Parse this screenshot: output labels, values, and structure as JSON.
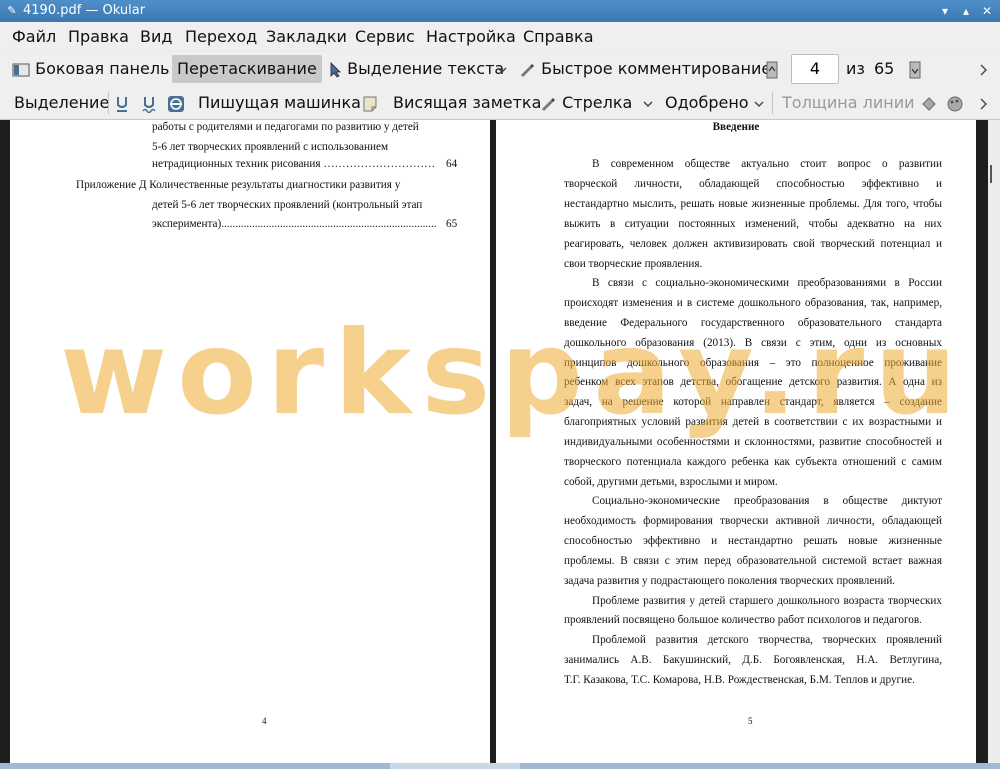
{
  "window": {
    "title": "4190.pdf  — Okular"
  },
  "menu": [
    "Файл",
    "Правка",
    "Вид",
    "Переход",
    "Закладки",
    "Сервис",
    "Настройка",
    "Справка"
  ],
  "toolbar1": {
    "sidebar": "Боковая панель",
    "drag": "Перетаскивание",
    "text_select": "Выделение текста",
    "quick_comment": "Быстрое комментирование",
    "page_current": "4",
    "page_of": "из",
    "page_total": "65"
  },
  "toolbar2": {
    "highlight": "Выделение",
    "typewriter": "Пишущая машинка",
    "note": "Висящая заметка",
    "arrow": "Стрелка",
    "approved": "Одобрено",
    "line_width": "Толщина линии"
  },
  "page_left": {
    "toc": [
      {
        "text": "работы с родителями и педагогами по развитию у детей",
        "page": ""
      },
      {
        "text": "5-6 лет творческих проявлений с использованием",
        "page": ""
      },
      {
        "text": "нетрадиционных техник рисования …………………………",
        "page": "64"
      },
      {
        "text": "Приложение Д Количественные результаты диагностики развития у",
        "page": ""
      },
      {
        "text": "детей 5-6 лет творческих проявлений (контрольный этап",
        "page": ""
      },
      {
        "text": "эксперимента)..............................................................................",
        "page": "65"
      }
    ],
    "page_number": "4"
  },
  "page_right": {
    "heading": "Введение",
    "lines": [
      "В современном обществе актуально стоит вопрос о развитии",
      "творческой личности, обладающей способностью эффективно и",
      "нестандартно мыслить, решать новые жизненные проблемы. Для того, чтобы",
      "выжить в ситуации постоянных изменений, чтобы адекватно на них",
      "реагировать, человек должен активизировать свой творческий потенциал и",
      "свои творческие проявления.",
      "В связи с социально-экономическими преобразованиями в России",
      "происходят изменения и в системе дошкольного образования, так, например,",
      "введение Федерального государственного образовательного стандарта",
      "дошкольного образования (2013). В связи с этим, одни из основных",
      "принципов дошкольного образования – это полноценное проживание",
      "ребенком всех этапов детства, обогащение детского развития. А одна из",
      "задач, на решение которой направлен стандарт, является – создание",
      "благоприятных условий развития детей в соответствии с их возрастными и",
      "индивидуальными особенностями и склонностями, развитие способностей и",
      "творческого потенциала каждого ребенка как субъекта отношений с самим",
      "собой, другими детьми, взрослыми и миром.",
      "Социально-экономические преобразования в обществе диктуют",
      "необходимость формирования творчески активной личности, обладающей",
      "способностью эффективно и нестандартно решать новые жизненные",
      "проблемы. В связи с этим перед образовательной системой встает важная",
      "задача развития у подрастающего поколения творческих проявлений.",
      "Проблеме развития у детей старшего дошкольного возраста творческих",
      "проявлений посвящено большое количество работ психологов и педагогов.",
      "Проблемой развития детского творчества, творческих проявлений",
      "занимались А.В. Бакушинский, Д.Б. Богоявленская, Н.А. Ветлугина,",
      "Т.Г. Казакова, Т.С. Комарова, Н.В. Рождественская, Б.М. Теплов и другие."
    ],
    "page_number": "5"
  },
  "watermark": "workspay.ru",
  "colors": {
    "titlebar": "#3b78b3",
    "watermark": "#ecac30",
    "doc_background": "#1e1e1e"
  }
}
